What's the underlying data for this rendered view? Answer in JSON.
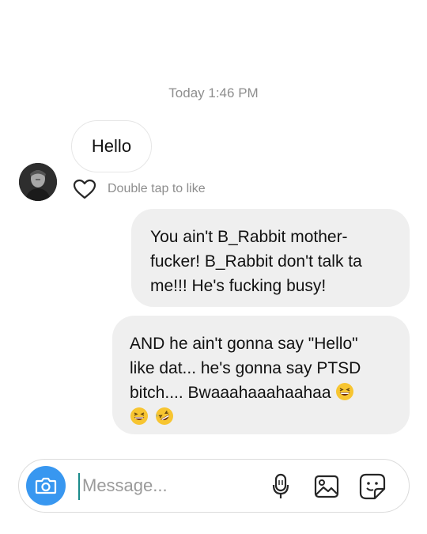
{
  "thread": {
    "timestamp": "Today 1:46 PM"
  },
  "incoming": {
    "message": "Hello",
    "like_hint": "Double tap to like",
    "avatar_icon": "user-avatar-icon"
  },
  "outgoing": [
    {
      "lines": [
        "You ain't B_Rabbit mother-",
        "fucker! B_Rabbit don't talk ta",
        "me!!! He's fucking busy!"
      ]
    },
    {
      "lines": [
        "AND he ain't gonna say \"Hello\"",
        "like dat... he's gonna say PTSD",
        "bitch.... Bwaaahaaahaahaa"
      ],
      "emojis": [
        "grinning-squinting-face-emoji",
        "grinning-squinting-face-emoji",
        "rolling-on-floor-laughing-emoji"
      ]
    }
  ],
  "composer": {
    "placeholder": "Message...",
    "icons": [
      "camera-icon",
      "microphone-icon",
      "gallery-icon",
      "sticker-icon"
    ]
  },
  "colors": {
    "accent": "#3897f0",
    "bubble_gray": "#efefef",
    "muted_text": "#8e8e8e"
  }
}
